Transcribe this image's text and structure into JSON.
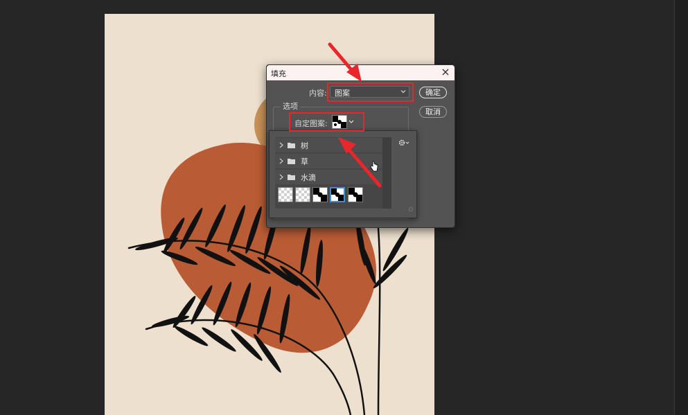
{
  "dialog": {
    "title": "填充",
    "content_label": "内容:",
    "content_value": "图案",
    "ok_label": "确定",
    "cancel_label": "取消",
    "options_label": "选项",
    "custom_pattern_label": "自定图案:"
  },
  "pattern_picker": {
    "groups": [
      {
        "name": "树"
      },
      {
        "name": "草"
      },
      {
        "name": "水滴"
      }
    ],
    "thumbnails": [
      "transparent-pattern",
      "transparent-pattern",
      "black-white-pattern",
      "black-white-pattern",
      "black-white-pattern"
    ],
    "selected_index": 3
  },
  "colors": {
    "canvas_bg": "#ede0cf",
    "leaf_shape": "#b95c35",
    "sun_shape": "#c79157",
    "highlight_red": "#e8262c",
    "selection_blue": "#3d8fd6"
  }
}
